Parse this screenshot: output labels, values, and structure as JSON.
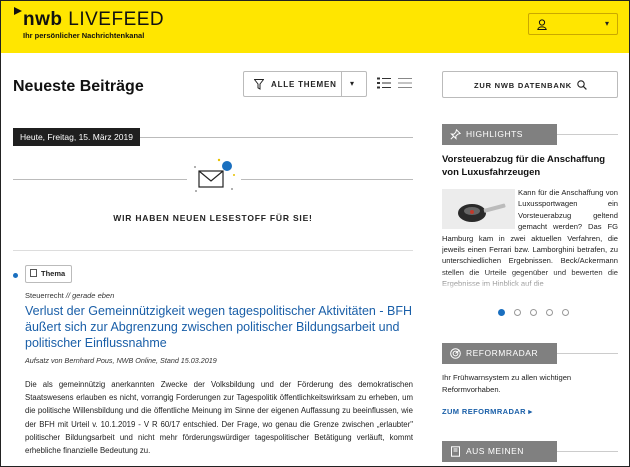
{
  "header": {
    "logo_bold": "nwb",
    "logo_light": "LIVEFEED",
    "tagline": "Ihr persönlicher Nachrichtenkanal",
    "user_icon": "user-icon",
    "caret": "▾",
    "accent_color": "#ffe600"
  },
  "main": {
    "page_title": "Neueste Beiträge",
    "filter": {
      "label": "ALLE THEMEN",
      "caret": "▾",
      "icon": "filter-icon"
    },
    "view_icons": [
      "list-view-icon",
      "menu-view-icon"
    ],
    "date_badge": "Heute, Freitag, 15. März 2019",
    "news_banner": "WIR HABEN NEUEN LESESTOFF FÜR SIE!",
    "article": {
      "badge": "Thema",
      "category": "Steuerrecht",
      "time_label": "// gerade eben",
      "title": "Verlust der Gemeinnützigkeit wegen tagespolitischer Aktivitäten - BFH äußert sich zur Abgrenzung zwischen politischer Bildungsarbeit und politischer Einflussnahme",
      "author": "Aufsatz von Bernhard Pous, NWB Online, Stand 15.03.2019",
      "body": "Die als gemeinnützig anerkannten Zwecke der Volksbildung und der Förderung des demokratischen Staatswesens erlauben es nicht, vorrangig Forderungen zur Tagespolitik öffentlichkeitswirksam zu erheben, um die politische Willensbildung und die öffentliche Meinung im Sinne der eigenen Auffassung zu beeinflussen, wie der BFH mit Urteil v. 10.1.2019 - V R 60/17 entschied. Der Frage, wo genau die Grenze zwischen „erlaubter\" politischer Bildungsarbeit und nicht mehr förderungswürdiger tagespolitischer Betätigung verläuft, kommt erhebliche finanzielle Bedeutung zu."
    },
    "link_color": "#1a5fa8"
  },
  "sidebar": {
    "db_button": "ZUR NWB DATENBANK",
    "highlights": {
      "heading": "HIGHLIGHTS",
      "title": "Vorsteuerabzug für die Anschaffung von Luxusfahrzeugen",
      "text": "Kann für die Anschaffung von Luxussportwagen ein Vorsteuerabzug geltend gemacht werden? Das FG Hamburg kam in zwei aktuellen Verfahren, die jeweils einen Ferrari bzw. Lamborghini betrafen, zu unterschiedlichen Ergebnissen. Beck/Ackermann stellen die Urteile gegenüber und bewerten die Ergebnisse im Hinblick auf die",
      "dots_total": 5,
      "dots_active": 0
    },
    "reformradar": {
      "heading": "REFORMRADAR",
      "text": "Ihr Frühwarnsystem zu allen wichtigen Reformvorhaben.",
      "link": "ZUM REFORMRADAR ▸"
    },
    "products": {
      "heading": "AUS MEINEN PRODUKTEN"
    }
  }
}
